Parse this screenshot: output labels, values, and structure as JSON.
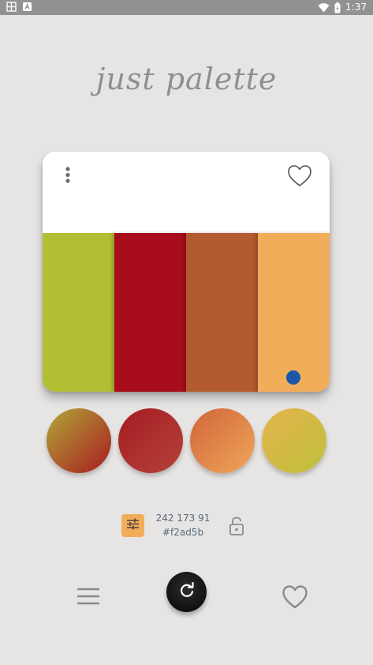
{
  "status_bar": {
    "time": "1:37",
    "icons": [
      "notification-icon",
      "app-badge-icon",
      "wifi-icon",
      "battery-icon"
    ]
  },
  "app": {
    "title": "just palette"
  },
  "palette": {
    "favorited": false,
    "selected_index": 3,
    "swatches": [
      {
        "hex": "#b1bf35"
      },
      {
        "hex": "#a70d1b"
      },
      {
        "hex": "#b35a30"
      },
      {
        "hex": "#f2ad5b"
      }
    ]
  },
  "gradients": [
    {
      "from": "#b1a73a",
      "to": "#a81c1e"
    },
    {
      "from": "#a51c22",
      "to": "#b5423a"
    },
    {
      "from": "#d0663a",
      "to": "#f0a55a"
    },
    {
      "from": "#e5b34f",
      "to": "#bfc03a"
    }
  ],
  "selected_color": {
    "rgb": "242 173 91",
    "hex": "#f2ad5b",
    "locked": false
  },
  "colors": {
    "background": "#e6e5e4",
    "status_bar": "#929292",
    "accent": "#f2ad5b",
    "selected_dot": "#1b57a8",
    "icon_gray": "#8a8a8a"
  }
}
